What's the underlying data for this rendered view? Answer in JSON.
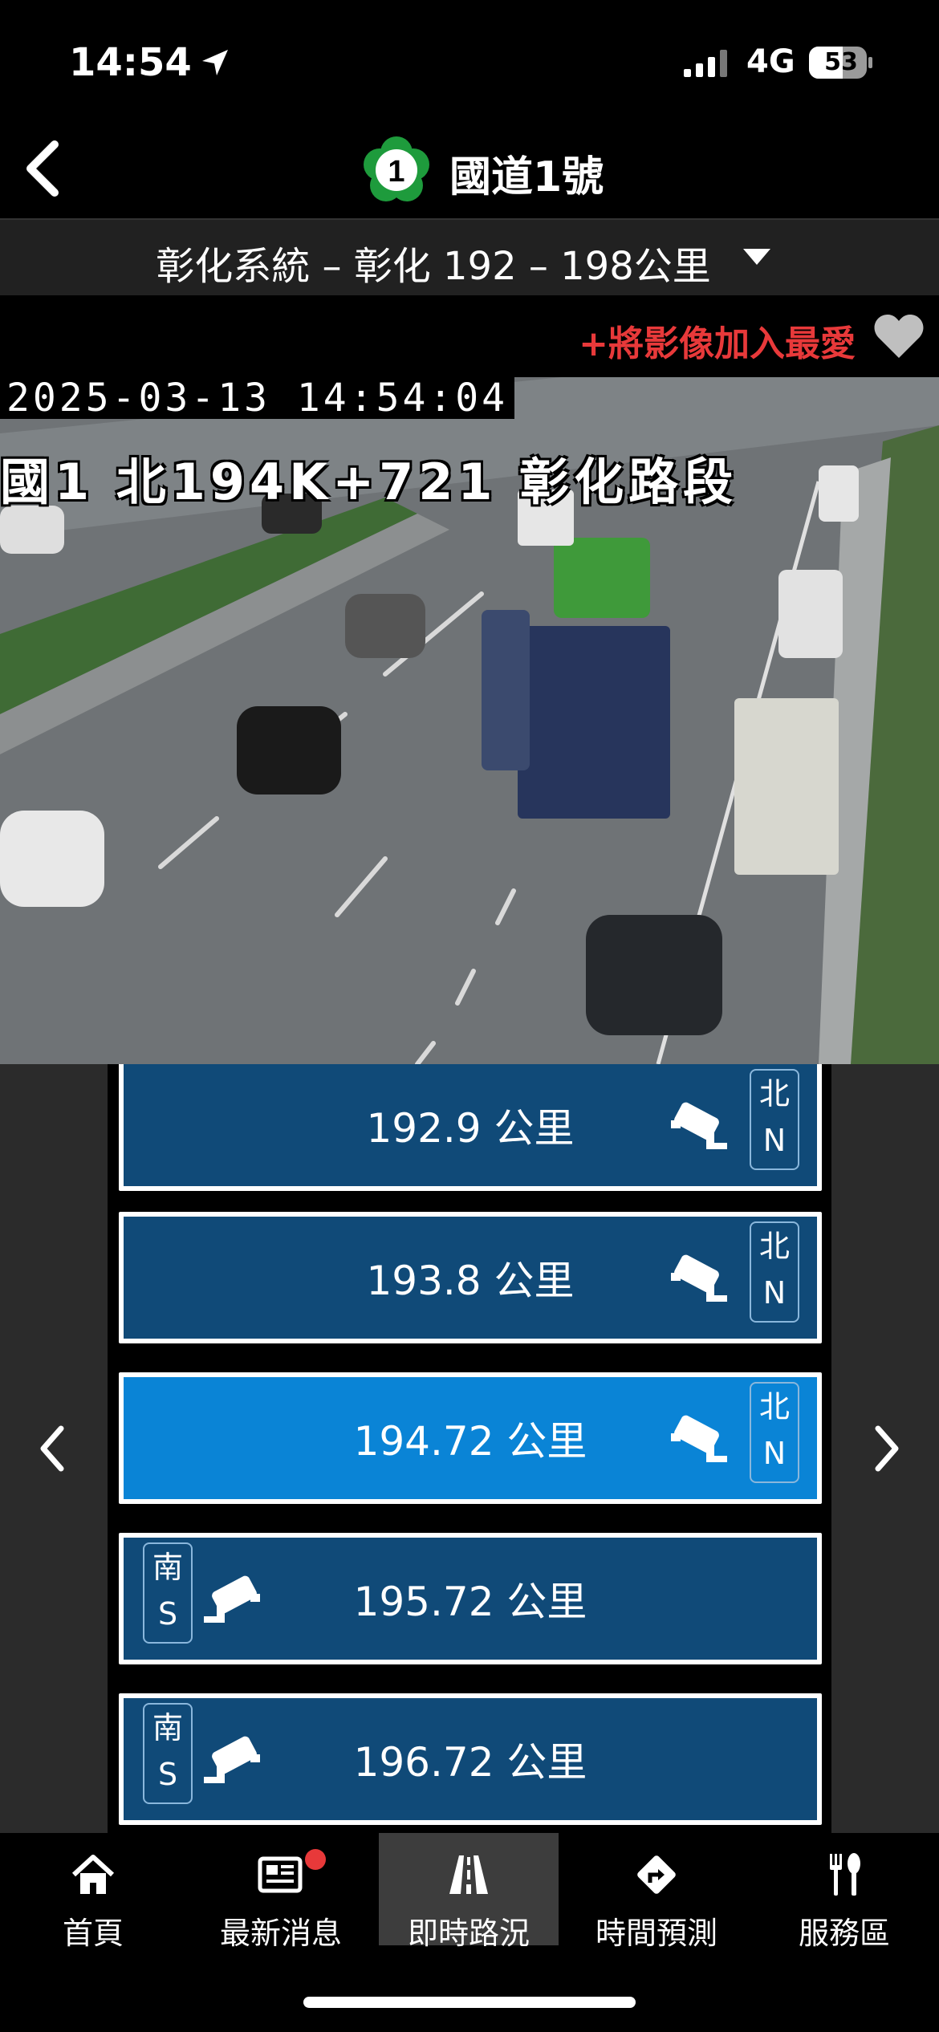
{
  "status": {
    "time": "14:54",
    "network": "4G",
    "battery": "53"
  },
  "nav": {
    "route_number": "1",
    "title": "國道1號"
  },
  "segment": {
    "label": "彰化系統 – 彰化 192 – 198公里"
  },
  "favorite": {
    "label": "+將影像加入最愛"
  },
  "camera_feed": {
    "timestamp": "2025-03-13  14:54:04",
    "location": "國1 北194K+721 彰化路段"
  },
  "cameras": [
    {
      "km": "192.9 公里",
      "dir_zh": "北",
      "dir_en": "N",
      "side": "north",
      "active": false
    },
    {
      "km": "193.8 公里",
      "dir_zh": "北",
      "dir_en": "N",
      "side": "north",
      "active": false
    },
    {
      "km": "194.72 公里",
      "dir_zh": "北",
      "dir_en": "N",
      "side": "north",
      "active": true
    },
    {
      "km": "195.72 公里",
      "dir_zh": "南",
      "dir_en": "S",
      "side": "south",
      "active": false
    },
    {
      "km": "196.72 公里",
      "dir_zh": "南",
      "dir_en": "S",
      "side": "south",
      "active": false
    }
  ],
  "tabs": [
    {
      "label": "首頁",
      "icon": "home-icon"
    },
    {
      "label": "最新消息",
      "icon": "news-icon",
      "badge": true
    },
    {
      "label": "即時路況",
      "icon": "road-icon",
      "active": true
    },
    {
      "label": "時間預測",
      "icon": "direction-sign-icon"
    },
    {
      "label": "服務區",
      "icon": "fork-knife-icon"
    }
  ],
  "colors": {
    "accent_red": "#e8393a",
    "item_blue": "#104a78",
    "item_active": "#0a84d6"
  }
}
